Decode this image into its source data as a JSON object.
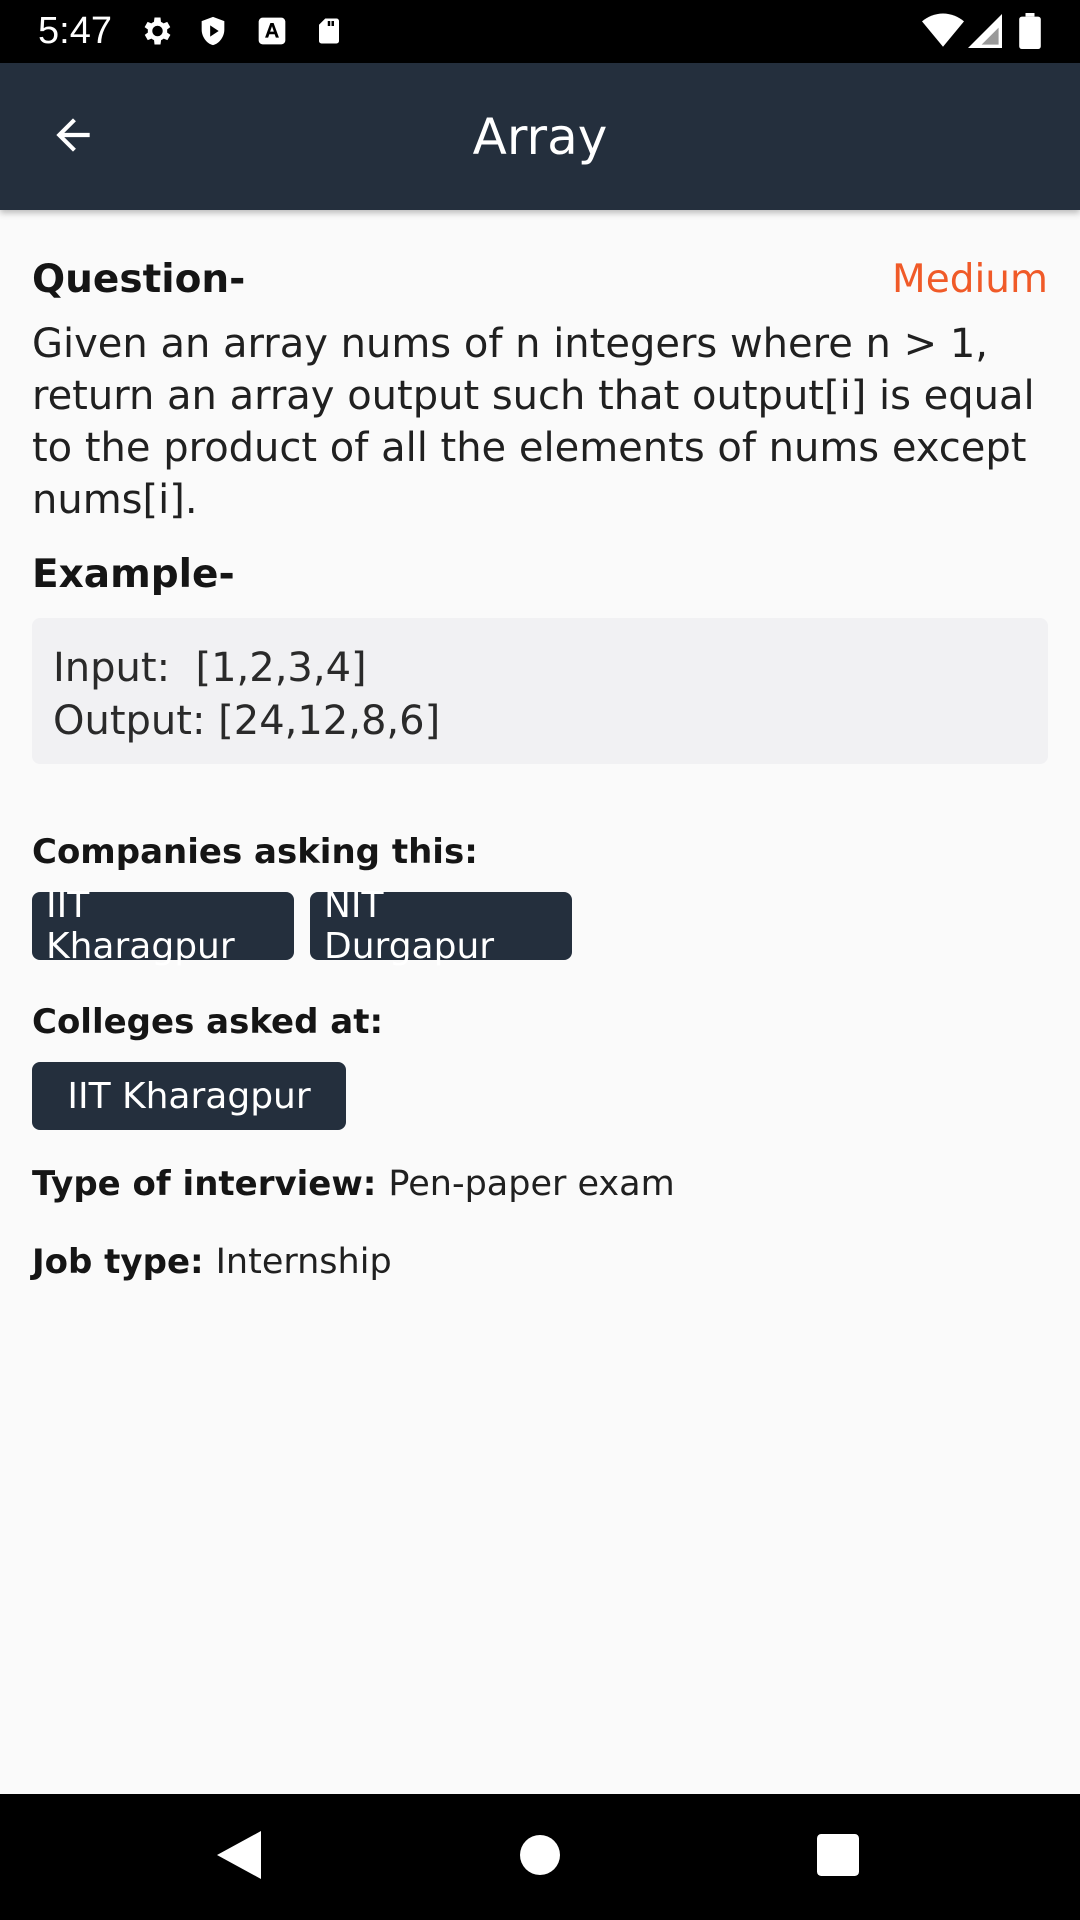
{
  "status_bar": {
    "time": "5:47",
    "icons_left": [
      "settings-icon",
      "shield-icon",
      "font-icon",
      "sd-card-icon"
    ],
    "icons_right": [
      "wifi-icon",
      "signal-icon",
      "battery-icon"
    ]
  },
  "app_bar": {
    "title": "Array",
    "back_icon": "arrow-back-icon"
  },
  "question": {
    "heading": "Question-",
    "difficulty": "Medium",
    "text": "Given an array nums of n integers where n > 1, return an array output such that output[i] is equal to the product of all the elements of nums except nums[i]."
  },
  "example": {
    "heading": "Example-",
    "input": "Input:  [1,2,3,4]",
    "output": "Output: [24,12,8,6]"
  },
  "companies": {
    "label": "Companies asking this:",
    "items": [
      "IIT Kharagpur",
      "NIT Durgapur"
    ]
  },
  "colleges": {
    "label": "Colleges asked at:",
    "items": [
      "IIT Kharagpur"
    ]
  },
  "interview": {
    "label": "Type of interview:",
    "value": "Pen-paper exam"
  },
  "job": {
    "label": "Job type:",
    "value": "Internship"
  },
  "nav_bar": {
    "icons": [
      "back-triangle-icon",
      "home-circle-icon",
      "recents-square-icon"
    ]
  },
  "colors": {
    "app_bar": "#242f3d",
    "difficulty": "#f05a28",
    "chip": "#242f3d",
    "background": "#fafafa"
  }
}
